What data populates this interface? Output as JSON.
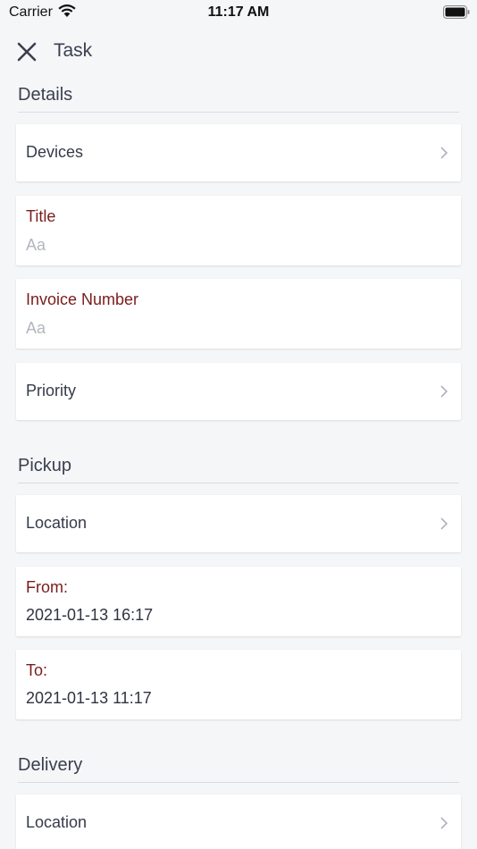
{
  "status_bar": {
    "carrier": "Carrier",
    "time": "11:17 AM"
  },
  "nav": {
    "title": "Task"
  },
  "details": {
    "title": "Details",
    "devices_label": "Devices",
    "title_field": {
      "label": "Title",
      "placeholder": "Aa"
    },
    "invoice_field": {
      "label": "Invoice Number",
      "placeholder": "Aa"
    },
    "priority_label": "Priority"
  },
  "pickup": {
    "title": "Pickup",
    "location_label": "Location",
    "from": {
      "label": "From:",
      "value": "2021-01-13 16:17"
    },
    "to": {
      "label": "To:",
      "value": "2021-01-13 11:17"
    }
  },
  "delivery": {
    "title": "Delivery",
    "location_label": "Location"
  },
  "colors": {
    "background": "#f5f6f8",
    "field_label": "#7a1c1c",
    "text": "#353a4a",
    "placeholder": "#b3b6be"
  }
}
